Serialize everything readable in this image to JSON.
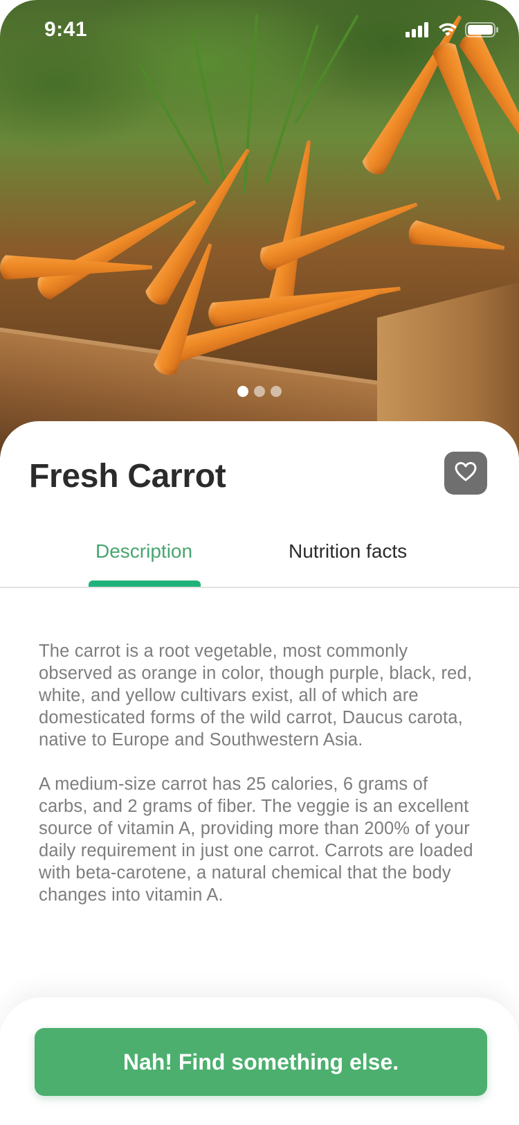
{
  "status_bar": {
    "time": "9:41",
    "icons": [
      "cellular-signal-icon",
      "wifi-icon",
      "battery-icon"
    ]
  },
  "hero": {
    "image_description_icon": "carrots-photo",
    "carousel": {
      "total": 3,
      "active_index": 0
    }
  },
  "product": {
    "title": "Fresh Carrot",
    "favorite_icon": "heart-outline-icon"
  },
  "tabs": [
    {
      "label": "Description",
      "active": true
    },
    {
      "label": "Nutrition facts",
      "active": false
    }
  ],
  "description": {
    "paragraphs": [
      "The carrot is a root vegetable, most commonly observed as orange in color, though purple, black, red, white, and yellow cultivars exist, all of which are domesticated forms of the wild carrot, Daucus carota, native to Europe and Southwestern Asia.",
      "A medium-size carrot has 25 calories, 6 grams of carbs, and 2 grams of fiber. The veggie is an excellent source of vitamin A, providing more than 200% of your daily requirement in just one carrot. Carrots are loaded with beta-carotene, a natural chemical that the body changes into vitamin A."
    ]
  },
  "cta": {
    "label": "Nah! Find something else."
  },
  "colors": {
    "accent": "#48a56f",
    "tab_indicator": "#1fb27a",
    "cta_bg": "#4caf6e",
    "favorite_bg": "#6f6f6f",
    "title": "#2b2b2b",
    "body_text": "#7d7d7d"
  }
}
